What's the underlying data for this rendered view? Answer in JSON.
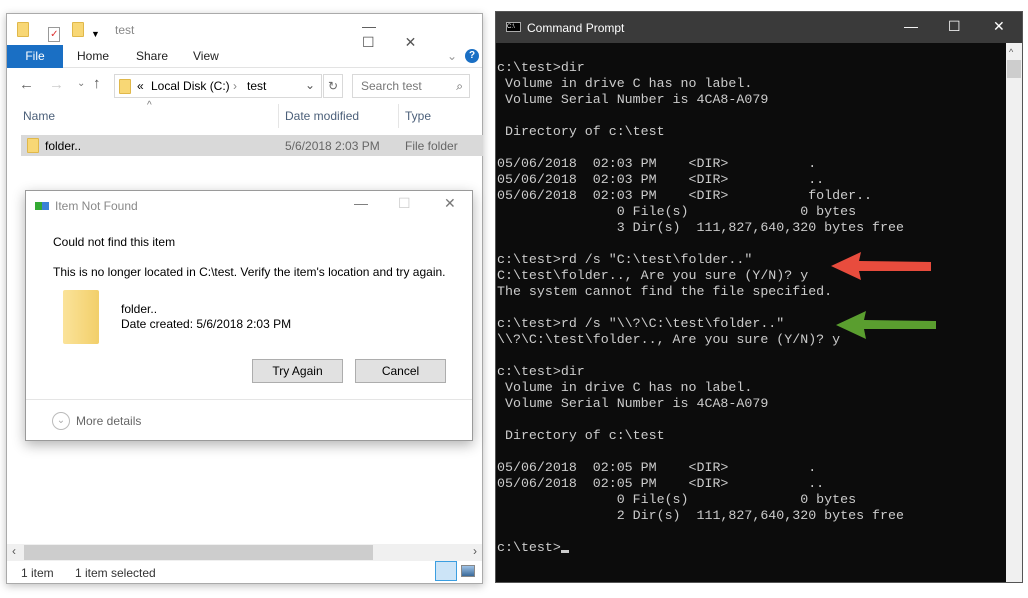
{
  "explorer": {
    "title": "test",
    "ribbon_tabs": [
      "File",
      "Home",
      "Share",
      "View"
    ],
    "address": {
      "overflow": "«",
      "segments": [
        "Local Disk (C:)",
        "test"
      ]
    },
    "search_placeholder": "Search test",
    "columns": [
      "Name",
      "Date modified",
      "Type"
    ],
    "rows": [
      {
        "name": "folder..",
        "date": "5/6/2018 2:03 PM",
        "type": "File folder"
      }
    ],
    "status": {
      "count": "1 item",
      "selected": "1 item selected"
    }
  },
  "dialog": {
    "title": "Item Not Found",
    "heading": "Could not find this item",
    "message": "This is no longer located in C:\\test. Verify the item's location and try again.",
    "item_name": "folder..",
    "item_date": "Date created: 5/6/2018 2:03 PM",
    "try_again": "Try Again",
    "cancel": "Cancel",
    "more_details": "More details"
  },
  "cmd": {
    "title": "Command Prompt",
    "lines": [
      "c:\\test>dir",
      " Volume in drive C has no label.",
      " Volume Serial Number is 4CA8-A079",
      "",
      " Directory of c:\\test",
      "",
      "05/06/2018  02:03 PM    <DIR>          .",
      "05/06/2018  02:03 PM    <DIR>          ..",
      "05/06/2018  02:03 PM    <DIR>          folder..",
      "               0 File(s)              0 bytes",
      "               3 Dir(s)  111,827,640,320 bytes free",
      "",
      "c:\\test>rd /s \"C:\\test\\folder..\"",
      "C:\\test\\folder.., Are you sure (Y/N)? y",
      "The system cannot find the file specified.",
      "",
      "c:\\test>rd /s \"\\\\?\\C:\\test\\folder..\"",
      "\\\\?\\C:\\test\\folder.., Are you sure (Y/N)? y",
      "",
      "c:\\test>dir",
      " Volume in drive C has no label.",
      " Volume Serial Number is 4CA8-A079",
      "",
      " Directory of c:\\test",
      "",
      "05/06/2018  02:05 PM    <DIR>          .",
      "05/06/2018  02:05 PM    <DIR>          ..",
      "               0 File(s)              0 bytes",
      "               2 Dir(s)  111,827,640,320 bytes free",
      "",
      "c:\\test>"
    ],
    "arrow_colors": {
      "red": "#e84c3d",
      "green": "#5a9e2f"
    }
  }
}
